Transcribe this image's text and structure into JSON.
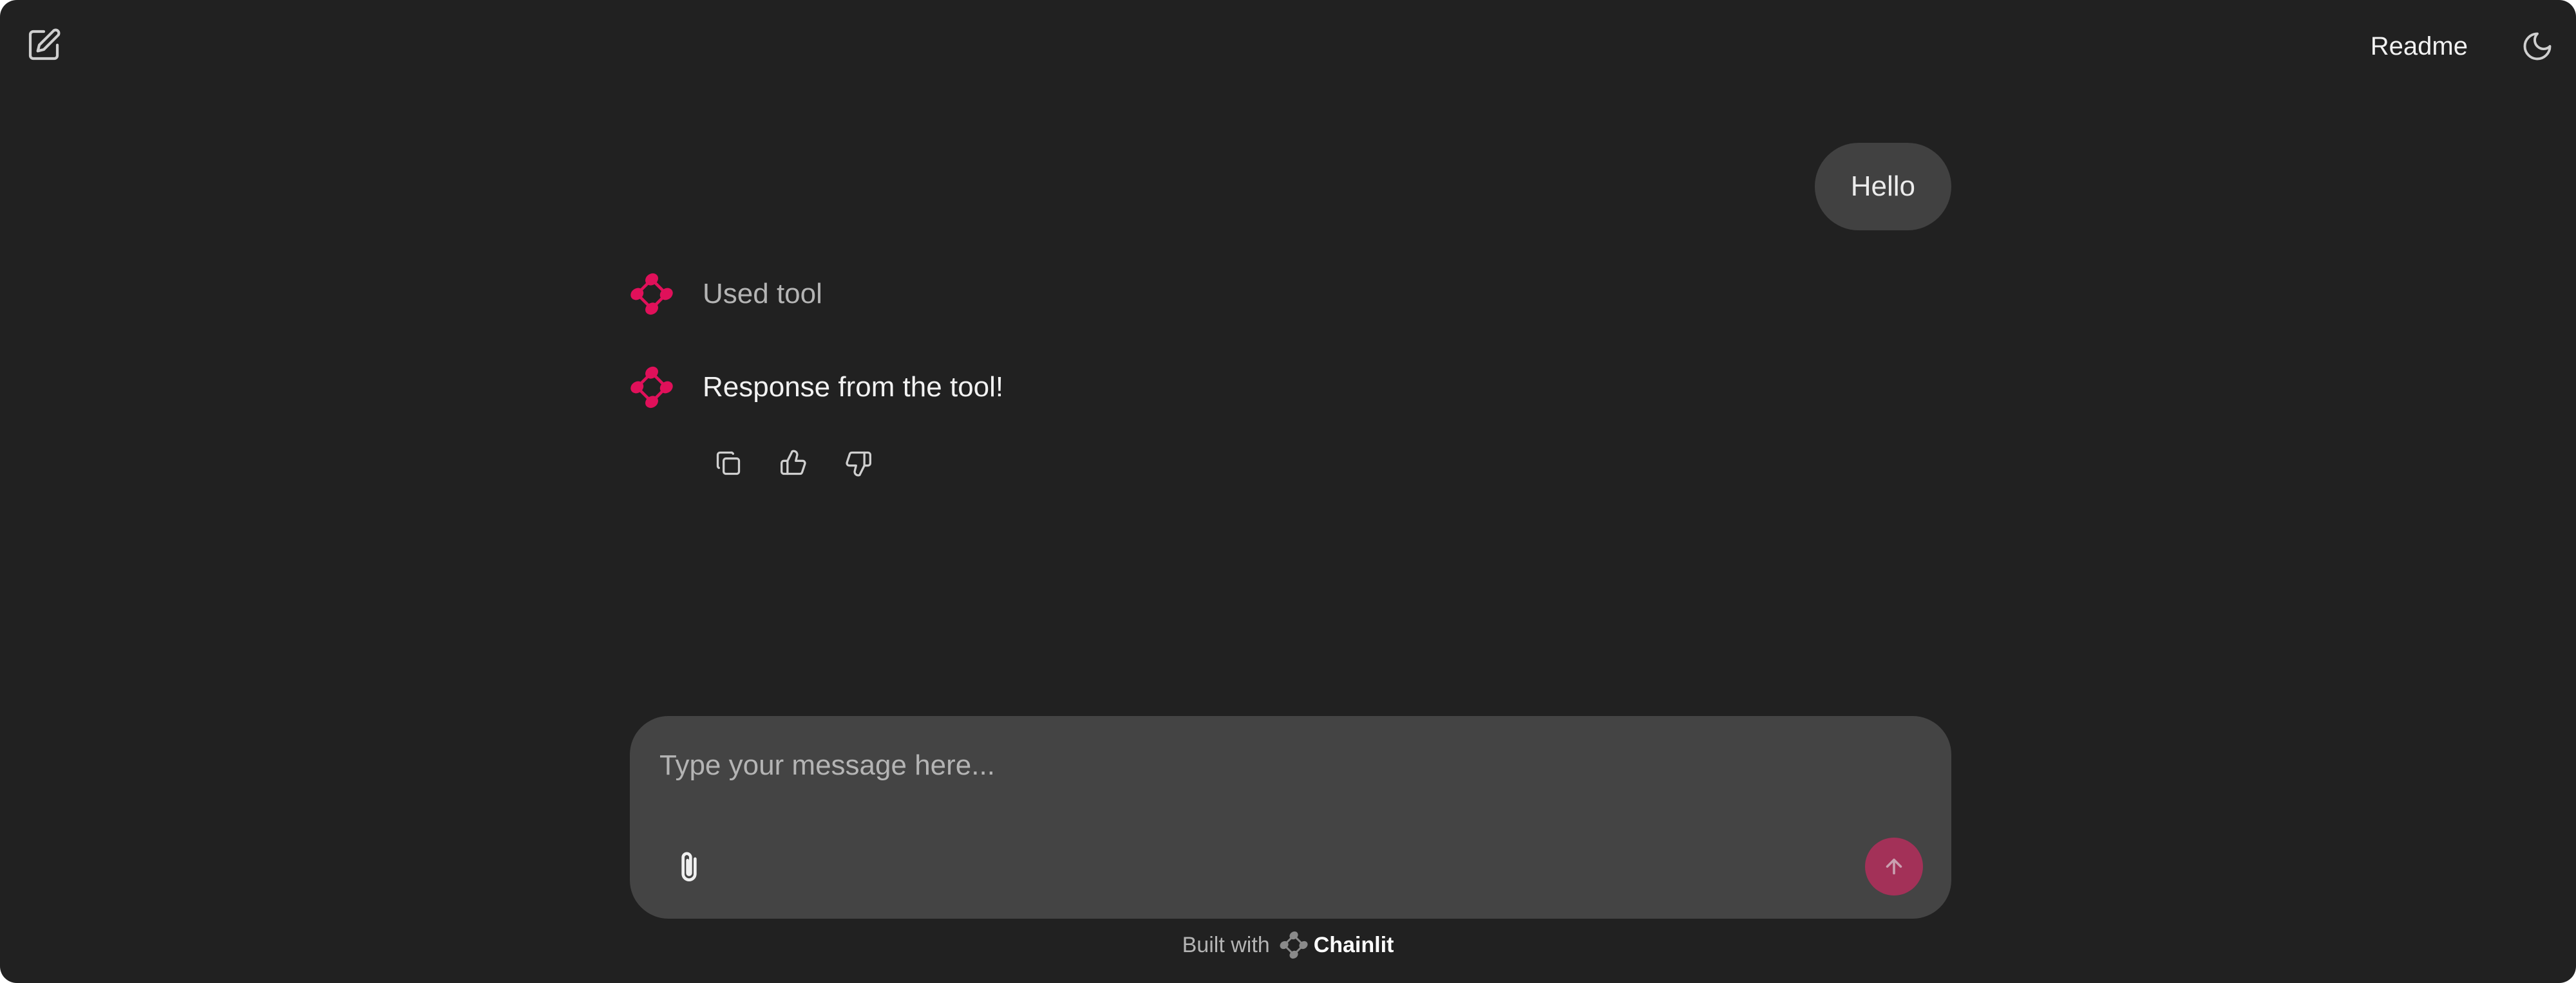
{
  "header": {
    "readme_label": "Readme",
    "new_chat_icon": "edit-icon",
    "theme_icon": "moon-icon"
  },
  "messages": {
    "user": {
      "text": "Hello"
    },
    "tool_step": {
      "text": "Used tool"
    },
    "assistant": {
      "text": "Response from the tool!",
      "actions": [
        "copy-icon",
        "thumbs-up-icon",
        "thumbs-down-icon"
      ]
    }
  },
  "composer": {
    "placeholder": "Type your message here...",
    "attach_icon": "paperclip-icon",
    "send_icon": "arrow-up-icon"
  },
  "footer": {
    "built_with": "Built with",
    "brand": "Chainlit"
  },
  "colors": {
    "background": "#212121",
    "bubble": "#414141",
    "composer": "#444444",
    "accent": "#e0105a",
    "send_button": "#a33158"
  }
}
